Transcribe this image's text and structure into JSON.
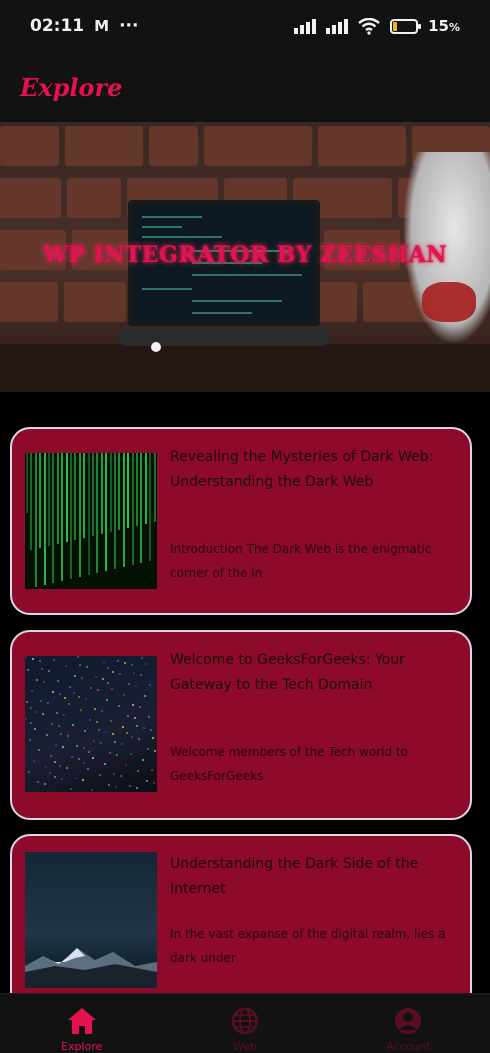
{
  "status_bar": {
    "time": "02:11",
    "gmail_icon": "M",
    "more": "···",
    "battery_percent": "15",
    "battery_level": 0.15
  },
  "app_bar": {
    "title": "Explore"
  },
  "banner": {
    "title": "WP INTEGRATOR BY ZEESHAN",
    "slide_index": 1
  },
  "posts": [
    {
      "title": "Revealing the Mysteries of Dark Web: Understanding the Dark Web",
      "excerpt": "Introduction The Dark Web is the enigmatic corner of the in",
      "thumbnail": "matrix-code"
    },
    {
      "title": "Welcome to GeeksForGeeks: Your Gateway to the Tech Domain",
      "excerpt": "Welcome members of the Tech world to GeeksForGeeks",
      "thumbnail": "dark-pixels"
    },
    {
      "title": "Understanding the Dark Side of the Internet",
      "excerpt": "In the vast expanse of the digital realm, lies a dark under",
      "thumbnail": "mountains"
    }
  ],
  "bottom_nav": [
    {
      "label": "Explore",
      "icon": "home-icon",
      "active": true
    },
    {
      "label": "Web",
      "icon": "globe-icon",
      "active": false
    },
    {
      "label": "Account",
      "icon": "account-icon",
      "active": false
    }
  ],
  "colors": {
    "accent": "#e4134f",
    "card": "#8d0a2b",
    "card_border": "#d9d9e8",
    "background": "#000000",
    "bar": "#121212"
  }
}
